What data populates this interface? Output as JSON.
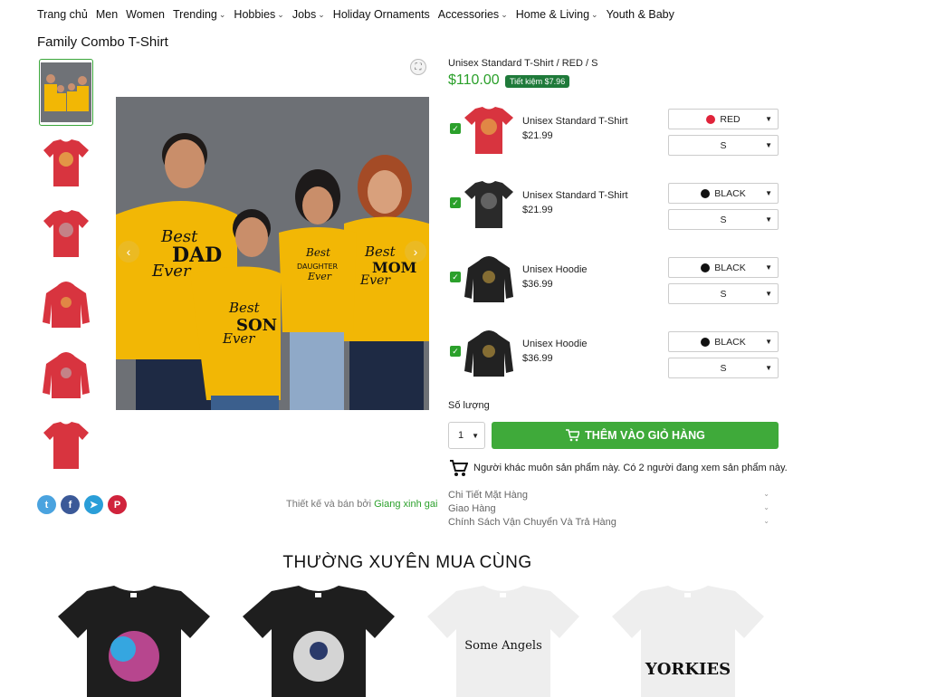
{
  "nav": [
    {
      "label": "Trang chủ",
      "chev": false
    },
    {
      "label": "Men",
      "chev": false
    },
    {
      "label": "Women",
      "chev": false
    },
    {
      "label": "Trending",
      "chev": true
    },
    {
      "label": "Hobbies",
      "chev": true
    },
    {
      "label": "Jobs",
      "chev": true
    },
    {
      "label": "Holiday Ornaments",
      "chev": false
    },
    {
      "label": "Accessories",
      "chev": true
    },
    {
      "label": "Home & Living",
      "chev": true
    },
    {
      "label": "Youth & Baby",
      "chev": false
    }
  ],
  "product": {
    "title": "Family Combo T-Shirt",
    "variant": "Unisex Standard T-Shirt /  RED /  S",
    "price": "$110.00",
    "save": "Tiết kiệm $7.96",
    "main_texts": {
      "dad": "Best DAD Ever",
      "son": "Best SON Ever",
      "daughter": "Best DAUGHTER Ever",
      "mom": "Best MOM Ever"
    }
  },
  "items": [
    {
      "name": "Unisex Standard T-Shirt",
      "price": "$21.99",
      "color": "RED",
      "color_hex": "#e0233a",
      "size": "S",
      "garment": "tee",
      "garment_hex": "#d8343f"
    },
    {
      "name": "Unisex Standard T-Shirt",
      "price": "$21.99",
      "color": "BLACK",
      "color_hex": "#111111",
      "size": "S",
      "garment": "tee",
      "garment_hex": "#2a2a2a"
    },
    {
      "name": "Unisex Hoodie",
      "price": "$36.99",
      "color": "BLACK",
      "color_hex": "#111111",
      "size": "S",
      "garment": "hoodie",
      "garment_hex": "#222222"
    },
    {
      "name": "Unisex Hoodie",
      "price": "$36.99",
      "color": "BLACK",
      "color_hex": "#111111",
      "size": "S",
      "garment": "hoodie",
      "garment_hex": "#222222"
    }
  ],
  "quantity": {
    "label": "Số lượng",
    "value": "1"
  },
  "cart_label": "THÊM VÀO GIỎ HÀNG",
  "watching": "Người khác muôn sản phẩm này. Có 2 người đang xem sản phẩm này.",
  "accordion": [
    "Chi Tiết Mặt Hàng",
    "Giao Hàng",
    "Chính Sách Vận Chuyển Và Trả Hàng"
  ],
  "designer": {
    "prefix": "Thiết kế và bán bởi",
    "name": "Giang xinh gai"
  },
  "related_title": "THƯỜNG XUYÊN MUA CÙNG",
  "related": [
    {
      "hex": "#1e1e1e",
      "text": ""
    },
    {
      "hex": "#1e1e1e",
      "text": ""
    },
    {
      "hex": "#eeeeee",
      "text": "Some Angels"
    },
    {
      "hex": "#eeeeee",
      "text": "YORKIES"
    }
  ],
  "colors": {
    "accent": "#3faa3a",
    "price": "#2ba02b",
    "save_bg": "#1f7a3a"
  }
}
